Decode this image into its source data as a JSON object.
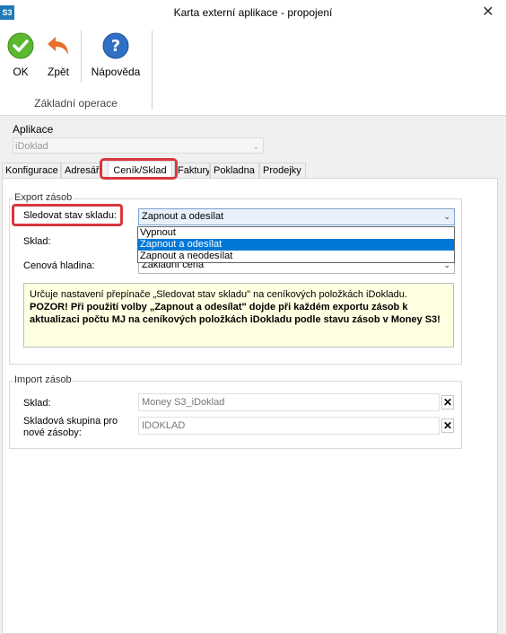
{
  "window": {
    "icon_text": "S3",
    "title": "Karta externí aplikace - propojení",
    "close_glyph": "✕"
  },
  "ribbon": {
    "ok_label": "OK",
    "back_label": "Zpět",
    "help_label": "Nápověda",
    "group_label": "Základní operace"
  },
  "application": {
    "label": "Aplikace",
    "value": "iDoklad"
  },
  "tabs": [
    "Konfigurace",
    "Adresář",
    "Ceník/Sklad",
    "Faktury",
    "Pokladna",
    "Prodejky"
  ],
  "export": {
    "group_title": "Export zásob",
    "track_label": "Sledovat stav skladu:",
    "track_value": "Zapnout a odesílat",
    "track_options": [
      "Vypnout",
      "Zapnout a odesílat",
      "Zapnout a neodesílat"
    ],
    "warehouse_label": "Sklad:",
    "price_level_label": "Cenová hladina:",
    "price_level_value": "Základní cena",
    "info_text_1": "Určuje nastavení přepínače „Sledovat stav skladu\" na ceníkových položkách iDokladu. ",
    "info_bold": "POZOR! Při použití volby „Zapnout a odesílat\" dojde při každém exportu zásob k aktualizaci počtu MJ na ceníkových položkách iDokladu podle stavu zásob v Money S3!"
  },
  "import": {
    "group_title": "Import zásob",
    "warehouse_label": "Sklad:",
    "warehouse_value": "Money S3_iDoklad",
    "group_label": "Skladová skupina pro nové zásoby:",
    "group_value": "IDOKLAD"
  },
  "colors": {
    "highlight": "#d9363e",
    "selection": "#0078d7",
    "info_bg": "#ffffe1"
  }
}
